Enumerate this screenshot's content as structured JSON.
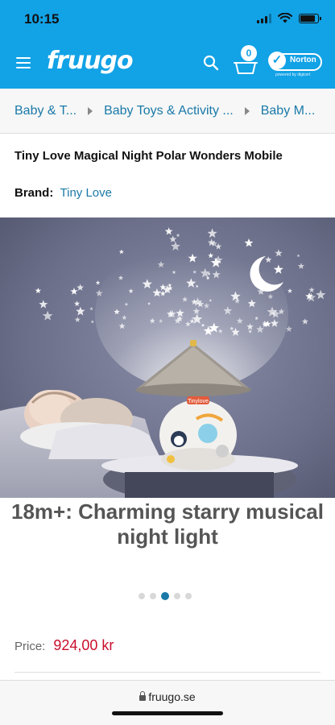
{
  "status_bar": {
    "time": "10:15",
    "battery_percent": 85,
    "signal_bars": 4
  },
  "header": {
    "logo": "fruugo",
    "cart_count": "0",
    "norton_label": "Norton",
    "norton_sub": "powered by digicert",
    "accent_color": "#12a2e6"
  },
  "breadcrumb": [
    {
      "label": "Baby & T..."
    },
    {
      "label": "Baby Toys & Activity ..."
    },
    {
      "label": "Baby M..."
    }
  ],
  "product": {
    "title": "Tiny Love Magical Night Polar Wonders Mobile",
    "brand_label": "Brand:",
    "brand": "Tiny Love",
    "image_badge": "Tinylove",
    "image_caption": "18m+: Charming starry musical night light",
    "carousel": {
      "count": 5,
      "active_index": 2
    },
    "price_label": "Price:",
    "price": "924,00 kr"
  },
  "browser": {
    "url": "fruugo.se"
  }
}
